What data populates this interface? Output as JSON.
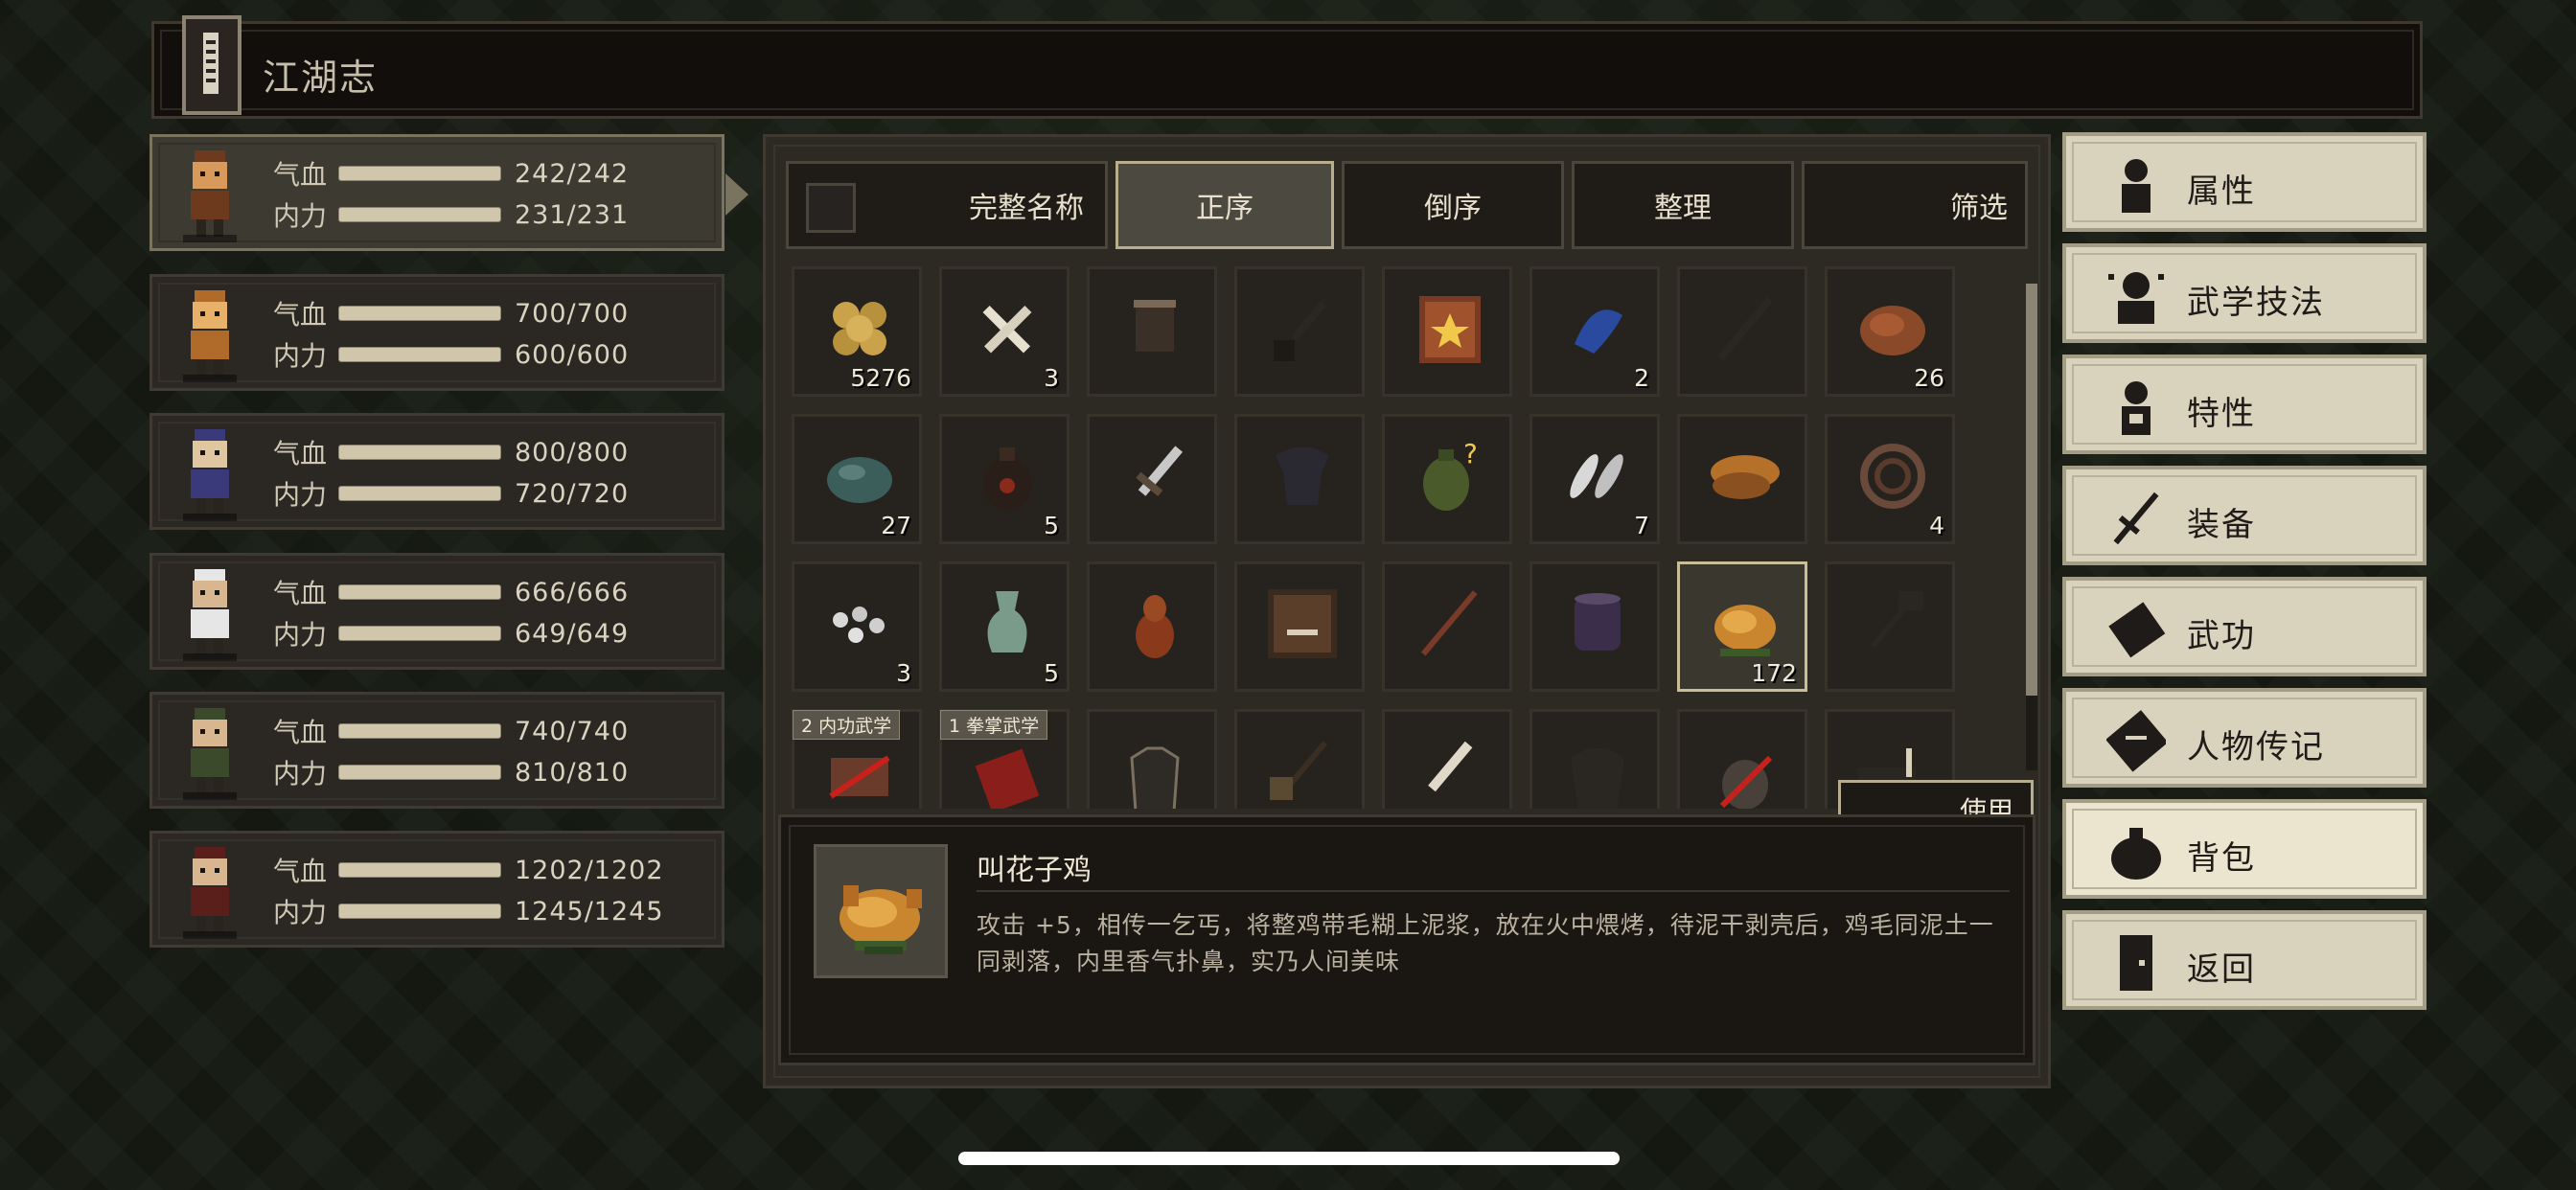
{
  "title": "江湖志",
  "party": [
    {
      "hp_label": "气血",
      "hp": "242/242",
      "mp_label": "内力",
      "mp": "231/231",
      "active": true
    },
    {
      "hp_label": "气血",
      "hp": "700/700",
      "mp_label": "内力",
      "mp": "600/600",
      "active": false
    },
    {
      "hp_label": "气血",
      "hp": "800/800",
      "mp_label": "内力",
      "mp": "720/720",
      "active": false
    },
    {
      "hp_label": "气血",
      "hp": "666/666",
      "mp_label": "内力",
      "mp": "649/649",
      "active": false
    },
    {
      "hp_label": "气血",
      "hp": "740/740",
      "mp_label": "内力",
      "mp": "810/810",
      "active": false
    },
    {
      "hp_label": "气血",
      "hp": "1202/1202",
      "mp_label": "内力",
      "mp": "1245/1245",
      "active": false
    }
  ],
  "sortbar": {
    "full_name": "完整名称",
    "ascending": "正序",
    "descending": "倒序",
    "organize": "整理",
    "filter": "筛选"
  },
  "inventory": [
    {
      "icon": "coins-icon",
      "count": "5276"
    },
    {
      "icon": "bones-icon",
      "count": "3"
    },
    {
      "icon": "bucket-icon",
      "count": ""
    },
    {
      "icon": "shovel-icon",
      "count": ""
    },
    {
      "icon": "treasure-map-icon",
      "count": ""
    },
    {
      "icon": "blue-herb-icon",
      "count": "2"
    },
    {
      "icon": "staff-icon",
      "count": ""
    },
    {
      "icon": "meat-icon",
      "count": "26"
    },
    {
      "icon": "stone-icon",
      "count": "27"
    },
    {
      "icon": "wine-jar-icon",
      "count": "5"
    },
    {
      "icon": "dagger-icon",
      "count": ""
    },
    {
      "icon": "armor-icon",
      "count": ""
    },
    {
      "icon": "potion-jar-icon",
      "count": ""
    },
    {
      "icon": "feather-icon",
      "count": "7"
    },
    {
      "icon": "mushroom-icon",
      "count": ""
    },
    {
      "icon": "coil-icon",
      "count": "4"
    },
    {
      "icon": "pebbles-icon",
      "count": "3"
    },
    {
      "icon": "vase-icon",
      "count": "5"
    },
    {
      "icon": "gourd-icon",
      "count": ""
    },
    {
      "icon": "chest-icon",
      "count": ""
    },
    {
      "icon": "spear-icon",
      "count": ""
    },
    {
      "icon": "pot-icon",
      "count": ""
    },
    {
      "icon": "roast-chicken-icon",
      "count": "172",
      "selected": true
    },
    {
      "icon": "rake-icon",
      "count": ""
    },
    {
      "icon": "scroll-crossed-icon",
      "count": "",
      "tag": "2 内功武学"
    },
    {
      "icon": "red-book-icon",
      "count": "",
      "tag": "1 拳掌武学"
    },
    {
      "icon": "robe-icon",
      "count": ""
    },
    {
      "icon": "broom-icon",
      "count": ""
    },
    {
      "icon": "knife-icon",
      "count": ""
    },
    {
      "icon": "armor-dark-icon",
      "count": ""
    },
    {
      "icon": "crossed-item-icon",
      "count": ""
    },
    {
      "icon": "chest-small-icon",
      "count": ""
    }
  ],
  "use_button": "使用",
  "detail": {
    "name": "叫花子鸡",
    "description": "攻击 +5，相传一乞丐，将整鸡带毛糊上泥浆，放在火中煨烤，待泥干剥壳后，鸡毛同泥土一同剥落，内里香气扑鼻，实乃人间美味"
  },
  "menu": [
    {
      "label": "属性",
      "icon": "figure-icon"
    },
    {
      "label": "武学技法",
      "icon": "martial-arts-icon"
    },
    {
      "label": "特性",
      "icon": "trait-icon"
    },
    {
      "label": "装备",
      "icon": "sword-icon"
    },
    {
      "label": "武功",
      "icon": "manual-icon"
    },
    {
      "label": "人物传记",
      "icon": "biography-icon"
    },
    {
      "label": "背包",
      "icon": "bag-icon",
      "active": true
    },
    {
      "label": "返回",
      "icon": "door-icon"
    }
  ],
  "colors": {
    "accent": "#c8bf98",
    "panel": "#2d2a24",
    "menu": "#d9d3bd"
  }
}
